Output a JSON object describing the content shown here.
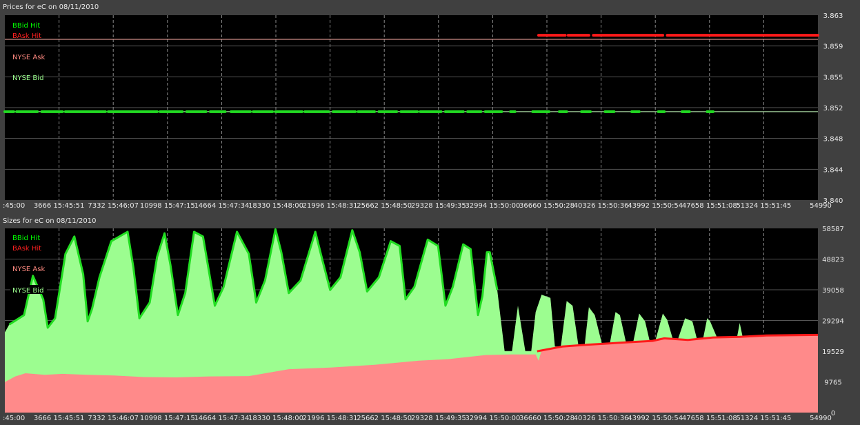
{
  "panels": {
    "prices": {
      "title": "Prices for  eC  on  08/11/2010",
      "legend": [
        {
          "label": "BBid Hit",
          "color": "#00ff00"
        },
        {
          "label": "BAsk Hit",
          "color": "#ff2020"
        },
        {
          "label": "NYSE Ask",
          "color": "#ff8a80"
        },
        {
          "label": "NYSE Bid",
          "color": "#9cff8f"
        }
      ]
    },
    "sizes": {
      "title": "Sizes for  eC  on  08/11/2010",
      "legend": [
        {
          "label": "BBid Hit",
          "color": "#00ff00"
        },
        {
          "label": "BAsk Hit",
          "color": "#ff2020"
        },
        {
          "label": "NYSE Ask",
          "color": "#ff8a80"
        },
        {
          "label": "NYSE Bid",
          "color": "#9cff8f"
        }
      ]
    }
  },
  "colors": {
    "bbid_hit": "#22dd22",
    "bask_hit": "#ff1a1a",
    "nyse_ask_area": "#ff8a8a",
    "nyse_bid_area": "#9cfd90",
    "plot_bg": "#000000",
    "frame_bg": "#404040",
    "grid": "#8a8a8a"
  },
  "chart_data": [
    {
      "type": "line",
      "title": "Prices for  eC  on  08/11/2010",
      "xlabel": "",
      "ylabel": "",
      "xlim": [
        0,
        54990
      ],
      "ylim": [
        3.84,
        3.863
      ],
      "x_ticks": [
        {
          "label": ":45:00",
          "x": 0
        },
        {
          "label": "3666 15:45:51",
          "x": 3666
        },
        {
          "label": "7332 15:46:07",
          "x": 7332
        },
        {
          "label": "10998 15:47:15",
          "x": 10998
        },
        {
          "label": "14664 15:47:34",
          "x": 14664
        },
        {
          "label": "18330 15:48:00",
          "x": 18330
        },
        {
          "label": "21996 15:48:31",
          "x": 21996
        },
        {
          "label": "25662 15:48:50",
          "x": 25662
        },
        {
          "label": "29328 15:49:35",
          "x": 29328
        },
        {
          "label": "32994 15:50:00",
          "x": 32994
        },
        {
          "label": "36660 15:50:28",
          "x": 36660
        },
        {
          "label": "40326 15:50:36",
          "x": 40326
        },
        {
          "label": "43992 15:50:54",
          "x": 43992
        },
        {
          "label": "47658 15:51:08",
          "x": 47658
        },
        {
          "label": "51324 15:51:45",
          "x": 51324
        },
        {
          "label": "54990",
          "x": 54990
        }
      ],
      "y_ticks": [
        "3.863",
        "3.859",
        "3.855",
        "3.852",
        "3.848",
        "3.844",
        "3.840"
      ],
      "grid": true,
      "legend_position": "top-left",
      "series": [
        {
          "name": "NYSE Ask",
          "x": [
            0,
            54990
          ],
          "y": [
            3.86,
            3.86
          ]
        },
        {
          "name": "NYSE Bid",
          "x": [
            0,
            54990
          ],
          "y": [
            3.851,
            3.851
          ]
        },
        {
          "name": "BAsk Hit",
          "segments": [
            [
              36100,
              37900
            ],
            [
              38100,
              39500
            ],
            [
              39800,
              44500
            ],
            [
              44800,
              54990
            ]
          ],
          "y": 3.8605
        },
        {
          "name": "BBid Hit",
          "segments": [
            [
              0,
              600
            ],
            [
              800,
              2200
            ],
            [
              2500,
              3900
            ],
            [
              4100,
              6800
            ],
            [
              7000,
              10300
            ],
            [
              10500,
              12000
            ],
            [
              12300,
              13600
            ],
            [
              13900,
              14900
            ],
            [
              15300,
              16600
            ],
            [
              16800,
              18100
            ],
            [
              18300,
              20100
            ],
            [
              20300,
              21900
            ],
            [
              22200,
              23700
            ],
            [
              23900,
              25000
            ],
            [
              25300,
              26500
            ],
            [
              26800,
              27900
            ],
            [
              28100,
              29500
            ],
            [
              29800,
              31000
            ],
            [
              31300,
              32200
            ],
            [
              32500,
              33600
            ],
            [
              34200,
              34500
            ],
            [
              35700,
              36800
            ],
            [
              37500,
              38000
            ],
            [
              39000,
              39600
            ],
            [
              40600,
              41200
            ],
            [
              42400,
              42900
            ],
            [
              44200,
              44600
            ],
            [
              45800,
              46300
            ],
            [
              47500,
              47900
            ]
          ],
          "y": 3.851
        }
      ]
    },
    {
      "type": "area",
      "title": "Sizes for  eC  on  08/11/2010",
      "xlabel": "",
      "ylabel": "",
      "xlim": [
        0,
        54990
      ],
      "ylim": [
        0,
        58587
      ],
      "x_ticks": [
        {
          "label": ":45:00",
          "x": 0
        },
        {
          "label": "3666 15:45:51",
          "x": 3666
        },
        {
          "label": "7332 15:46:07",
          "x": 7332
        },
        {
          "label": "10998 15:47:15",
          "x": 10998
        },
        {
          "label": "14664 15:47:34",
          "x": 14664
        },
        {
          "label": "18330 15:48:00",
          "x": 18330
        },
        {
          "label": "21996 15:48:31",
          "x": 21996
        },
        {
          "label": "25662 15:48:50",
          "x": 25662
        },
        {
          "label": "29328 15:49:35",
          "x": 29328
        },
        {
          "label": "32994 15:50:00",
          "x": 32994
        },
        {
          "label": "36660 15:50:28",
          "x": 36660
        },
        {
          "label": "40326 15:50:36",
          "x": 40326
        },
        {
          "label": "43992 15:50:54",
          "x": 43992
        },
        {
          "label": "47658 15:51:08",
          "x": 47658
        },
        {
          "label": "51324 15:51:45",
          "x": 51324
        },
        {
          "label": "54990",
          "x": 54990
        }
      ],
      "y_ticks": [
        "58587",
        "48823",
        "39058",
        "29294",
        "19529",
        "9765",
        "0"
      ],
      "grid": true,
      "legend_position": "top-left",
      "series": [
        {
          "name": "NYSE Bid",
          "x": [
            0,
            300,
            1300,
            1900,
            2600,
            2900,
            3400,
            4100,
            4700,
            5300,
            5600,
            5900,
            6400,
            7200,
            8300,
            8700,
            9100,
            9800,
            10300,
            10800,
            11200,
            11700,
            12200,
            12800,
            13400,
            14200,
            14800,
            15700,
            16500,
            17000,
            17600,
            18300,
            18700,
            19200,
            20000,
            21000,
            21500,
            22000,
            22700,
            23500,
            24000,
            24500,
            25300,
            26100,
            26700,
            27100,
            27700,
            28600,
            29300,
            29800,
            30300,
            31000,
            31500,
            32000,
            32300,
            32600,
            32800,
            33300,
            33800,
            34300,
            34700,
            35200,
            35600,
            35900,
            36300,
            36900,
            37200,
            37600,
            38000,
            38400,
            38800,
            39200,
            39500,
            39900,
            40400,
            40900,
            41300,
            41600,
            42000,
            42500,
            42900,
            43300,
            43600,
            44000,
            44500,
            44800,
            45200,
            45500,
            46000,
            46500,
            46800,
            47200,
            47500,
            47700,
            48200,
            48700,
            49500,
            49700,
            49900,
            50500,
            54990
          ],
          "y": [
            25500,
            28000,
            31000,
            43500,
            36000,
            27000,
            30000,
            50500,
            56000,
            44000,
            29000,
            33000,
            43000,
            54500,
            57500,
            46000,
            30000,
            35000,
            49500,
            57000,
            47000,
            31000,
            38000,
            57500,
            56000,
            34000,
            40000,
            57500,
            50500,
            35000,
            42000,
            58300,
            51000,
            38000,
            42000,
            57500,
            48000,
            39000,
            43000,
            58000,
            51000,
            38500,
            43000,
            54500,
            53000,
            36000,
            40000,
            55000,
            53000,
            34000,
            40000,
            53500,
            52000,
            31000,
            37000,
            51000,
            51000,
            39000,
            19500,
            19500,
            34000,
            19500,
            19500,
            32000,
            37500,
            36500,
            21000,
            21000,
            35500,
            34000,
            21000,
            21000,
            33500,
            31000,
            21500,
            21500,
            32000,
            31000,
            22500,
            22500,
            31500,
            29000,
            23000,
            23000,
            31500,
            29500,
            23000,
            23000,
            30000,
            29000,
            23500,
            23000,
            30000,
            29000,
            23500,
            23500,
            23500,
            28500,
            24000,
            24500,
            24500
          ]
        },
        {
          "name": "NYSE Ask",
          "x": [
            0,
            700,
            1400,
            2700,
            3900,
            5600,
            7400,
            9400,
            11600,
            13800,
            16500,
            19200,
            22000,
            25000,
            28000,
            30000,
            32500,
            34200,
            35900,
            36100,
            36300,
            37700,
            39400,
            40500,
            41600,
            43800,
            44600,
            46200,
            47900,
            49700,
            51500,
            54990
          ],
          "y": [
            9700,
            11500,
            12500,
            12000,
            12300,
            12000,
            11800,
            11300,
            11200,
            11500,
            11600,
            13800,
            14300,
            15200,
            16500,
            17000,
            18300,
            18500,
            18500,
            16500,
            19800,
            21100,
            21800,
            22100,
            22400,
            23000,
            23700,
            23200,
            24000,
            24200,
            24600,
            24800
          ]
        },
        {
          "name": "BAsk Hit",
          "x": [
            36000,
            37700,
            39400,
            40500,
            41600,
            43800,
            44600,
            46200,
            47900,
            49700,
            51500,
            54990
          ],
          "y": [
            19500,
            21000,
            21600,
            21900,
            22200,
            22800,
            23600,
            23100,
            23900,
            24100,
            24500,
            24700
          ]
        },
        {
          "name": "BBid Hit",
          "x": [
            300,
            1300,
            1900,
            2600,
            2900,
            3400,
            4100,
            4700,
            5300,
            5600,
            5900,
            6400,
            7200,
            8300,
            8700,
            9100,
            9800,
            10300,
            10800,
            11200,
            11700,
            12200,
            12800,
            13400,
            14200,
            14800,
            15700,
            16500,
            17000,
            17600,
            18300,
            18700,
            19200,
            20000,
            21000,
            21500,
            22000,
            22700,
            23500,
            24000,
            24500,
            25300,
            26100,
            26700,
            27100,
            27700,
            28600,
            29300,
            29800,
            30300,
            31000,
            31500,
            32000,
            32300,
            32600,
            32800,
            33300
          ],
          "y": [
            28000,
            31000,
            43500,
            36000,
            27000,
            30000,
            50500,
            56000,
            44000,
            29000,
            33000,
            43000,
            54500,
            57500,
            46000,
            30000,
            35000,
            49500,
            57000,
            47000,
            31000,
            38000,
            57500,
            56000,
            34000,
            40000,
            57500,
            50500,
            35000,
            42000,
            58300,
            51000,
            38000,
            42000,
            57500,
            48000,
            39000,
            43000,
            58000,
            51000,
            38500,
            43000,
            54500,
            53000,
            36000,
            40000,
            55000,
            53000,
            34000,
            40000,
            53500,
            52000,
            31000,
            37000,
            51000,
            51000,
            39000
          ]
        }
      ]
    }
  ]
}
